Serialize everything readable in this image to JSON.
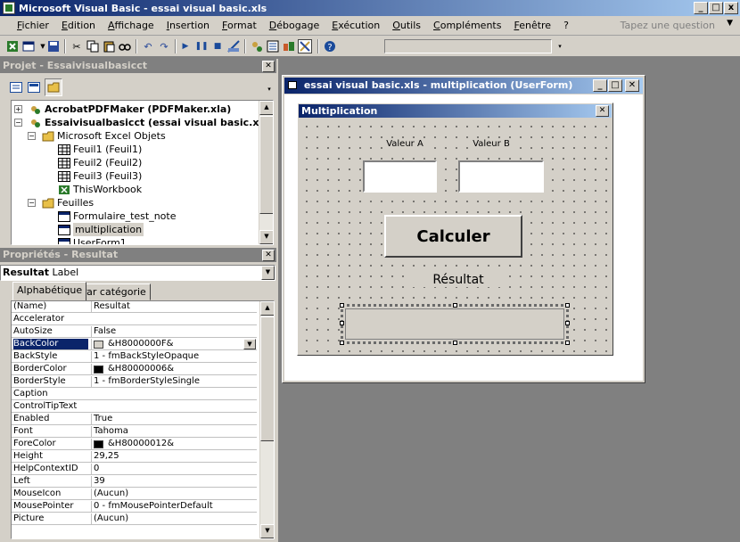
{
  "window": {
    "title": "Microsoft Visual Basic - essai visual basic.xls",
    "buttons": [
      "_",
      "□",
      "x"
    ]
  },
  "menu": {
    "items": [
      "Fichier",
      "Edition",
      "Affichage",
      "Insertion",
      "Format",
      "Débogage",
      "Exécution",
      "Outils",
      "Compléments",
      "Fenêtre",
      "?"
    ],
    "help_search": "Tapez une question"
  },
  "project": {
    "title": "Projet - Essaivisualbasicct",
    "tree": [
      {
        "label": "AcrobatPDFMaker (PDFMaker.xla)",
        "bold": true
      },
      {
        "label": "Essaivisualbasicct (essai visual basic.xls)",
        "bold": true
      },
      {
        "label": "Microsoft Excel Objets"
      },
      {
        "label": "Feuil1 (Feuil1)"
      },
      {
        "label": "Feuil2 (Feuil2)"
      },
      {
        "label": "Feuil3 (Feuil3)"
      },
      {
        "label": "ThisWorkbook"
      },
      {
        "label": "Feuilles"
      },
      {
        "label": "Formulaire_test_note"
      },
      {
        "label": "multiplication",
        "selected": true
      },
      {
        "label": "UserForm1"
      }
    ]
  },
  "properties": {
    "title": "Propriétés - Resultat",
    "object_name": "Resultat",
    "object_type": "Label",
    "tabs": [
      "Alphabétique",
      "Par catégorie"
    ],
    "rows": [
      {
        "name": "(Name)",
        "value": "Resultat"
      },
      {
        "name": "Accelerator",
        "value": ""
      },
      {
        "name": "AutoSize",
        "value": "False"
      },
      {
        "name": "BackColor",
        "value": "&H8000000F&",
        "swatch": "#d4d0c8",
        "selected": true
      },
      {
        "name": "BackStyle",
        "value": "1 - fmBackStyleOpaque"
      },
      {
        "name": "BorderColor",
        "value": "&H80000006&",
        "swatch": "#000000"
      },
      {
        "name": "BorderStyle",
        "value": "1 - fmBorderStyleSingle"
      },
      {
        "name": "Caption",
        "value": ""
      },
      {
        "name": "ControlTipText",
        "value": ""
      },
      {
        "name": "Enabled",
        "value": "True"
      },
      {
        "name": "Font",
        "value": "Tahoma"
      },
      {
        "name": "ForeColor",
        "value": "&H80000012&",
        "swatch": "#000000"
      },
      {
        "name": "Height",
        "value": "29,25"
      },
      {
        "name": "HelpContextID",
        "value": "0"
      },
      {
        "name": "Left",
        "value": "39"
      },
      {
        "name": "MouseIcon",
        "value": "(Aucun)"
      },
      {
        "name": "MousePointer",
        "value": "0 - fmMousePointerDefault"
      },
      {
        "name": "Picture",
        "value": "(Aucun)"
      }
    ]
  },
  "form_window": {
    "title": "essai visual basic.xls - multiplication (UserForm)",
    "userform": {
      "caption": "Multiplication",
      "label_a": "Valeur A",
      "label_b": "Valeur B",
      "button": "Calculer",
      "result_label": "Résultat"
    }
  }
}
